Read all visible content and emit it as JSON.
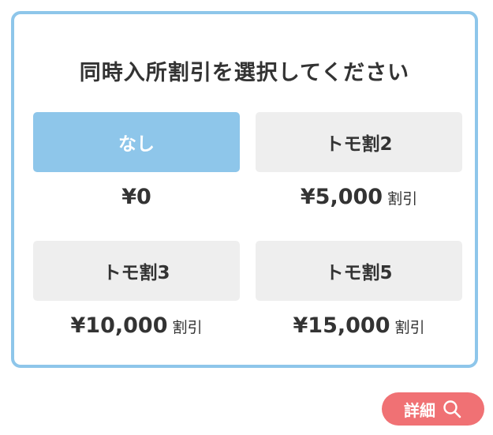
{
  "title": "同時入所割引を選択してください",
  "options": [
    {
      "label": "なし",
      "price": "¥0",
      "suffix": "",
      "selected": true
    },
    {
      "label": "トモ割2",
      "price": "¥5,000",
      "suffix": "割引",
      "selected": false
    },
    {
      "label": "トモ割3",
      "price": "¥10,000",
      "suffix": "割引",
      "selected": false
    },
    {
      "label": "トモ割5",
      "price": "¥15,000",
      "suffix": "割引",
      "selected": false
    }
  ],
  "detail_button": {
    "label": "詳細",
    "icon": "search-icon"
  },
  "colors": {
    "accent": "#8ec6ea",
    "option_bg": "#eeeeee",
    "detail_bg": "#f07174",
    "text": "#333333"
  }
}
